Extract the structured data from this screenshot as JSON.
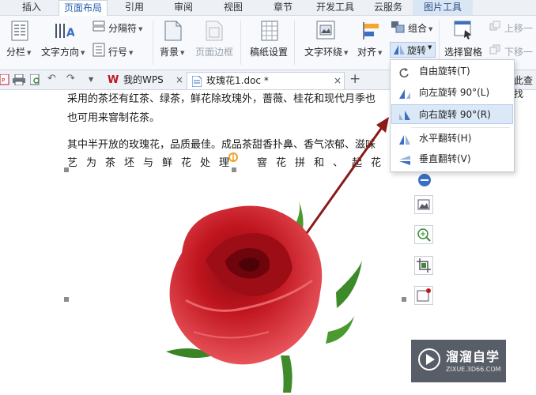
{
  "tabs": [
    {
      "label": "插入"
    },
    {
      "label": "页面布局"
    },
    {
      "label": "引用"
    },
    {
      "label": "审阅"
    },
    {
      "label": "视图"
    },
    {
      "label": "章节"
    },
    {
      "label": "开发工具"
    },
    {
      "label": "云服务"
    },
    {
      "label": "图片工具"
    }
  ],
  "ribbon": {
    "separator_label": "分隔符",
    "columns_label": "分栏",
    "text_direction_label": "文字方向",
    "line_number_label": "行号",
    "background_label": "背景",
    "page_border_label": "页面边框",
    "draft_label": "稿纸设置",
    "wrap_label": "文字环绕",
    "align_label": "对齐",
    "group_label": "组合",
    "rotate_label": "旋转",
    "selection_pane_label": "选择窗格",
    "bring_forward_label": "上移一",
    "send_backward_label": "下移一"
  },
  "docbar": {
    "wps_tab": "我的WPS",
    "doc_tab": "玫瑰花1.doc *",
    "add": "+",
    "right_fragment": "此查找"
  },
  "document": {
    "line1": "采用的茶坯有红茶、绿茶，鲜花除玫瑰外，蔷薇、桂花和现代月季也",
    "line2": "也可用来窨制花茶。",
    "line3": "其中半开放的玫瑰花，品质最佳。成品茶甜香扑鼻、香气浓郁、滋味",
    "line4_chars": [
      "艺",
      "为",
      "茶",
      "坯",
      "与",
      "鲜",
      "花",
      "处",
      "理",
      "",
      "窨",
      "花",
      "拼",
      "和",
      "、",
      "起",
      "花",
      "、"
    ]
  },
  "rotate_menu": {
    "items": [
      {
        "label": "自由旋转(T)",
        "icon": "free-rotate-icon"
      },
      {
        "label": "向左旋转 90°(L)",
        "icon": "rotate-left-icon"
      },
      {
        "label": "向右旋转 90°(R)",
        "icon": "rotate-right-icon"
      },
      {
        "label": "水平翻转(H)",
        "icon": "flip-horizontal-icon"
      },
      {
        "label": "垂直翻转(V)",
        "icon": "flip-vertical-icon"
      }
    ],
    "hovered_index": 2
  },
  "watermark": {
    "title": "溜溜自学",
    "url": "ZIXUE.3D66.COM"
  },
  "colors": {
    "accent": "#2a61b3",
    "menu_hover": "#dbe8f8",
    "arrow": "#8b1a1a",
    "rose": "#c0151f"
  }
}
